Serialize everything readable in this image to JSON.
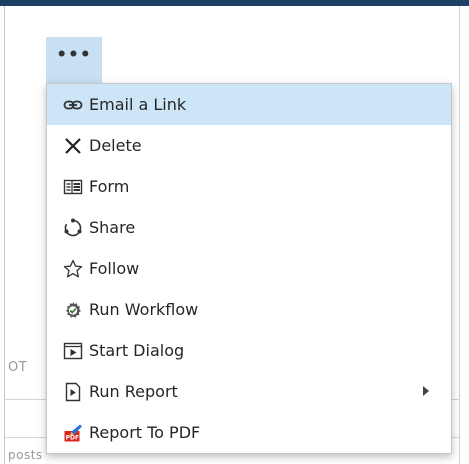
{
  "more_button": {
    "label": "•••"
  },
  "background": {
    "partial_text_1": "OT",
    "partial_text_2": "posts"
  },
  "menu": {
    "items": [
      {
        "label": "Email a Link",
        "icon": "link-icon",
        "highlighted": true
      },
      {
        "label": "Delete",
        "icon": "delete-x-icon"
      },
      {
        "label": "Form",
        "icon": "form-icon"
      },
      {
        "label": "Share",
        "icon": "share-icon"
      },
      {
        "label": "Follow",
        "icon": "star-icon"
      },
      {
        "label": "Run Workflow",
        "icon": "workflow-icon"
      },
      {
        "label": "Start Dialog",
        "icon": "dialog-play-icon"
      },
      {
        "label": "Run Report",
        "icon": "report-play-icon",
        "has_submenu": true
      },
      {
        "label": "Report To PDF",
        "icon": "pdf-icon"
      }
    ]
  },
  "colors": {
    "top_bar": "#1e3f66",
    "highlight": "#cde6f7",
    "button_active": "#c7e0f4"
  }
}
